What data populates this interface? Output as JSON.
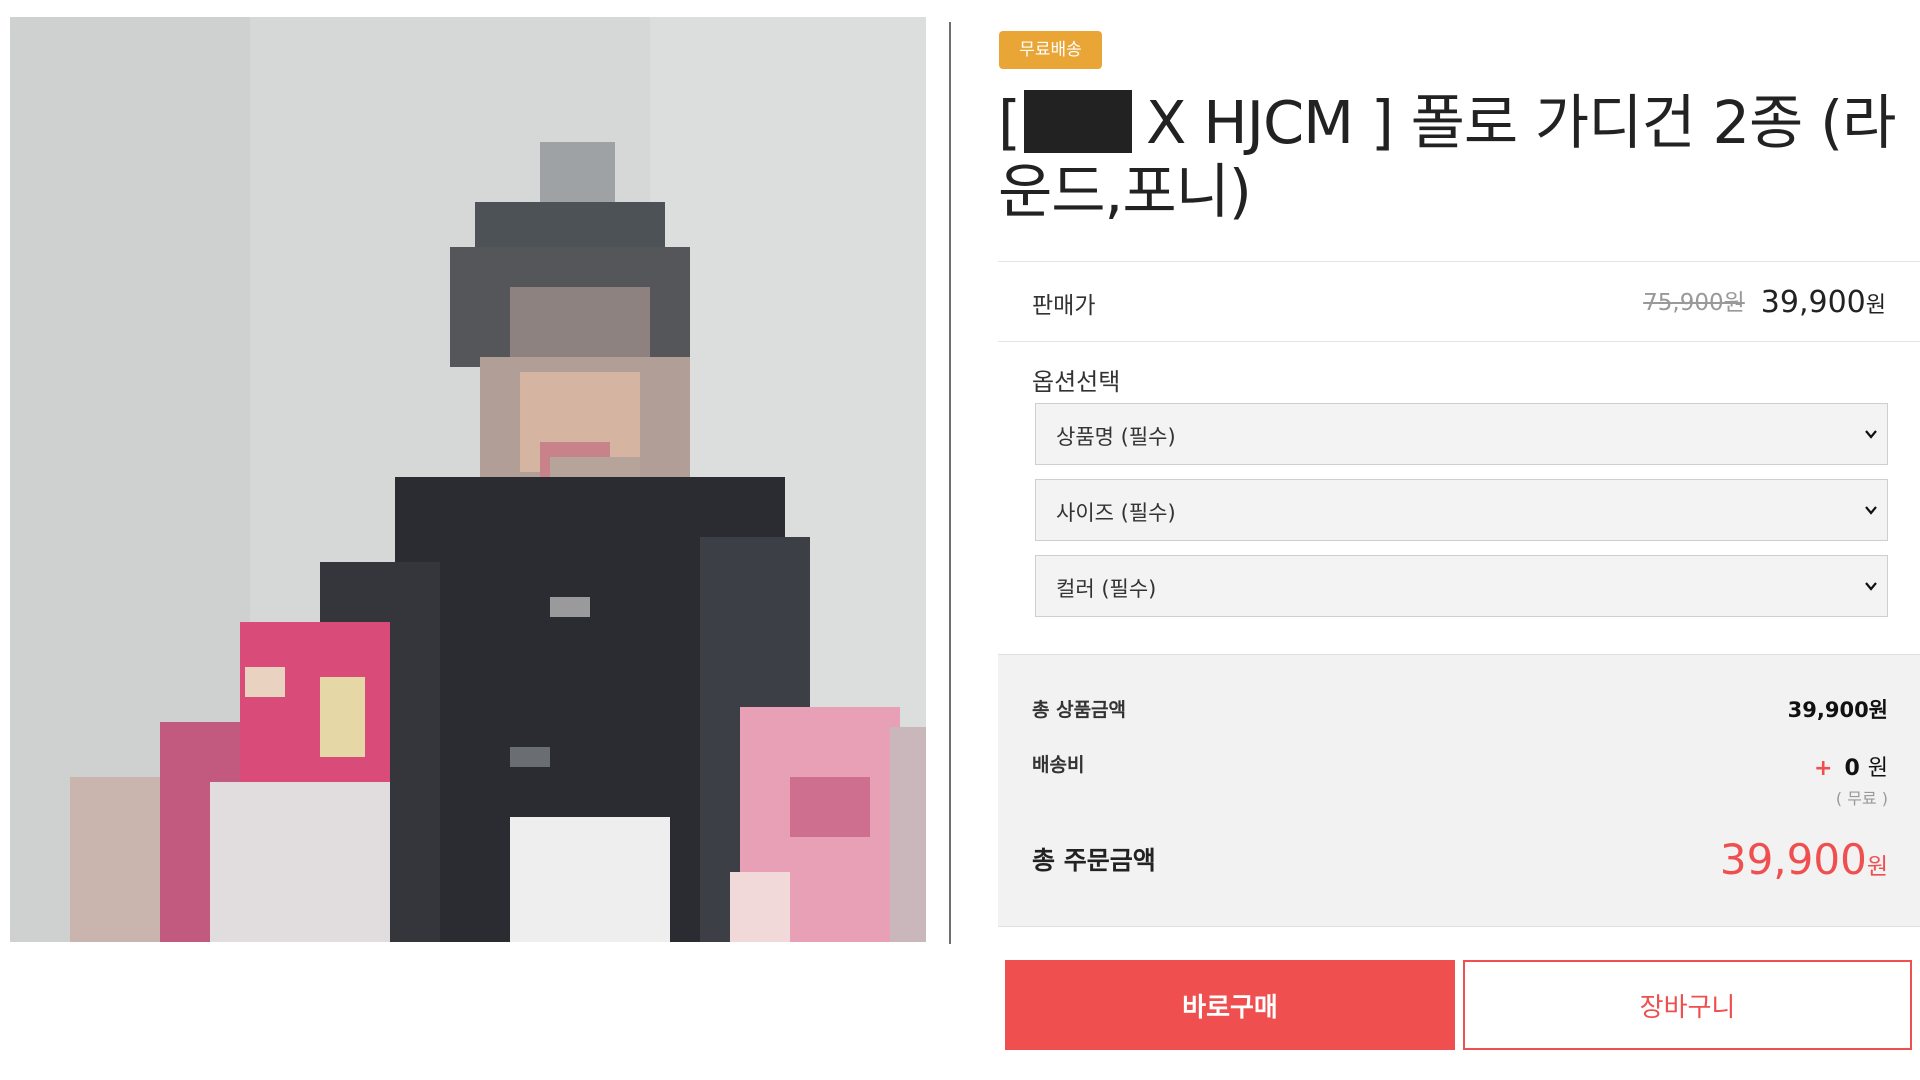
{
  "product_image": {
    "alt": "product-photo",
    "colors": {
      "background": "#d6d8d7",
      "cardigan": "#2b2c31",
      "pink": "#d94b78",
      "hair": "#4d5257"
    }
  },
  "badge": "무료배송",
  "title": {
    "prefix": "[",
    "suffix": "X HJCM ] 폴로 가디건 2종 (라운드,포니)"
  },
  "price": {
    "label": "판매가",
    "original": "75,900원",
    "current": "39,900",
    "unit": "원"
  },
  "options": {
    "title": "옵션선택",
    "selects": [
      {
        "value": "상품명 (필수)"
      },
      {
        "value": "사이즈 (필수)"
      },
      {
        "value": "컬러 (필수)"
      }
    ]
  },
  "summary": {
    "product_total_label": "총 상품금액",
    "product_total_value": "39,900원",
    "shipping_label": "배송비",
    "shipping_plus": "+",
    "shipping_value": "0",
    "shipping_unit": "원",
    "shipping_note": "( 무료 )",
    "order_total_label": "총 주문금액",
    "order_total_value": "39,900",
    "order_total_unit": "원"
  },
  "buttons": {
    "buy_now": "바로구매",
    "cart": "장바구니"
  },
  "accent_color": "#ef4f4f",
  "badge_color": "#e9a637"
}
